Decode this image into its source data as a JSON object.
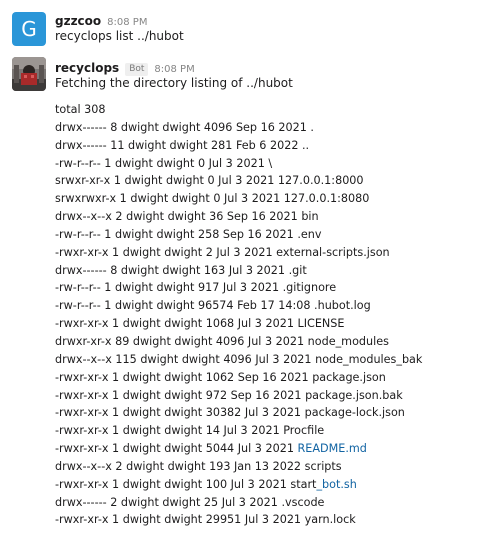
{
  "messages": [
    {
      "user": "gzzcoo",
      "avatar_letter": "G",
      "avatar_color": "#2a96d8",
      "time": "8:08 PM",
      "text": "recyclops list ../hubot"
    },
    {
      "user": "recyclops",
      "badge": "Bot",
      "time": "8:08 PM",
      "text": "Fetching the directory listing of ../hubot"
    }
  ],
  "listing": [
    {
      "text": "total 308"
    },
    {
      "text": "drwx------ 8 dwight dwight 4096 Sep 16 2021 ."
    },
    {
      "text": "drwx------ 11 dwight dwight 281 Feb 6 2022 .."
    },
    {
      "text": "-rw-r--r-- 1 dwight dwight 0 Jul 3 2021 \\"
    },
    {
      "text": "srwxr-xr-x 1 dwight dwight 0 Jul 3 2021 127.0.0.1:8000"
    },
    {
      "text": "srwxrwxr-x 1 dwight dwight 0 Jul 3 2021 127.0.0.1:8080"
    },
    {
      "text": "drwx--x--x 2 dwight dwight 36 Sep 16 2021 bin"
    },
    {
      "text": "-rw-r--r-- 1 dwight dwight 258 Sep 16 2021 .env"
    },
    {
      "text": "-rwxr-xr-x 1 dwight dwight 2 Jul 3 2021 external-scripts.json"
    },
    {
      "text": "drwx------ 8 dwight dwight 163 Jul 3 2021 .git"
    },
    {
      "text": "-rw-r--r-- 1 dwight dwight 917 Jul 3 2021 .gitignore"
    },
    {
      "text": "-rw-r--r-- 1 dwight dwight 96574 Feb 17 14:08 .hubot.log"
    },
    {
      "text": "-rwxr-xr-x 1 dwight dwight 1068 Jul 3 2021 LICENSE"
    },
    {
      "text": "drwxr-xr-x 89 dwight dwight 4096 Jul 3 2021 node_modules"
    },
    {
      "text": "drwx--x--x 115 dwight dwight 4096 Jul 3 2021 node_modules_bak"
    },
    {
      "text": "-rwxr-xr-x 1 dwight dwight 1062 Sep 16 2021 package.json"
    },
    {
      "text": "-rwxr-xr-x 1 dwight dwight 972 Sep 16 2021 package.json.bak"
    },
    {
      "text": "-rwxr-xr-x 1 dwight dwight 30382 Jul 3 2021 package-lock.json"
    },
    {
      "text": "-rwxr-xr-x 1 dwight dwight 14 Jul 3 2021 Procfile"
    },
    {
      "prefix": "-rwxr-xr-x 1 dwight dwight 5044 Jul 3 2021 ",
      "link": "README.md"
    },
    {
      "text": "drwx--x--x 2 dwight dwight 193 Jan 13 2022 scripts"
    },
    {
      "prefix": "-rwxr-xr-x 1 dwight dwight 100 Jul 3 2021 start",
      "link": "_bot.sh"
    },
    {
      "text": "drwx------ 2 dwight dwight 25 Jul 3 2021 .vscode"
    },
    {
      "text": "-rwxr-xr-x 1 dwight dwight 29951 Jul 3 2021 yarn.lock"
    }
  ],
  "colors": {
    "link": "#1264a3",
    "text": "#1d1c1d",
    "timestamp": "#868686"
  }
}
